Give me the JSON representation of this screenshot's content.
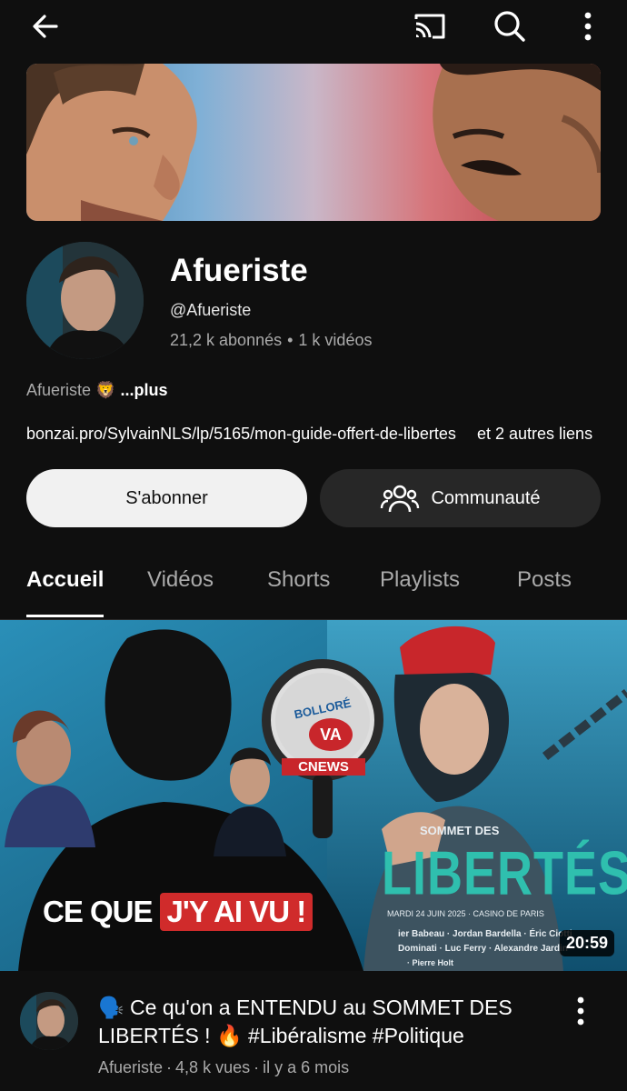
{
  "icons": {
    "back": "arrow-left-icon",
    "cast": "cast-icon",
    "search": "search-icon",
    "menu": "more-vertical-icon",
    "community": "people-icon"
  },
  "channel": {
    "name": "Afueriste",
    "handle": "@Afueriste",
    "subscribers": "21,2 k abonnés",
    "separator": "•",
    "videos": "1 k vidéos",
    "description": "Afueriste 🦁",
    "more_label": "...plus",
    "link": "bonzai.pro/SylvainNLS/lp/5165/mon-guide-offert-de-libertes",
    "other_links": "et 2 autres liens"
  },
  "actions": {
    "subscribe": "S'abonner",
    "community": "Communauté"
  },
  "tabs": [
    {
      "label": "Accueil",
      "active": true
    },
    {
      "label": "Vidéos",
      "active": false
    },
    {
      "label": "Shorts",
      "active": false
    },
    {
      "label": "Playlists",
      "active": false
    },
    {
      "label": "Posts",
      "active": false
    }
  ],
  "thumbnail": {
    "caption_white": "CE QUE",
    "caption_highlight": "J'Y AI VU !",
    "badge_top": "BOLLORÉ",
    "badge_mid": "VA",
    "badge_bottom": "CNEWS",
    "poster_small": "SOMMET DES",
    "poster_big": "LIBERTÉS",
    "poster_date": "MARDI 24 JUIN 2025 · CASINO DE PARIS",
    "poster_names": "ier Babeau · Jordan Bardella · Éric Ciotti",
    "poster_names2": "Dominati · Luc Ferry · Alexandre Jardin",
    "poster_names3": "· Pierre Holt",
    "duration": "20:59"
  },
  "video": {
    "title": "🗣️ Ce qu'on a ENTENDU au SOMMET DES LIBERTÉS ! 🔥 #Libéralisme #Politique",
    "channel": "Afueriste",
    "views": "4,8 k vues",
    "age": "il y a 6 mois",
    "separator": "·"
  },
  "colors": {
    "background": "#0f0f0f",
    "subscribe_bg": "#f1f1f1",
    "community_bg": "#272727",
    "highlight_red": "#d02b2b",
    "poster_blue": "#1a7fa8"
  }
}
